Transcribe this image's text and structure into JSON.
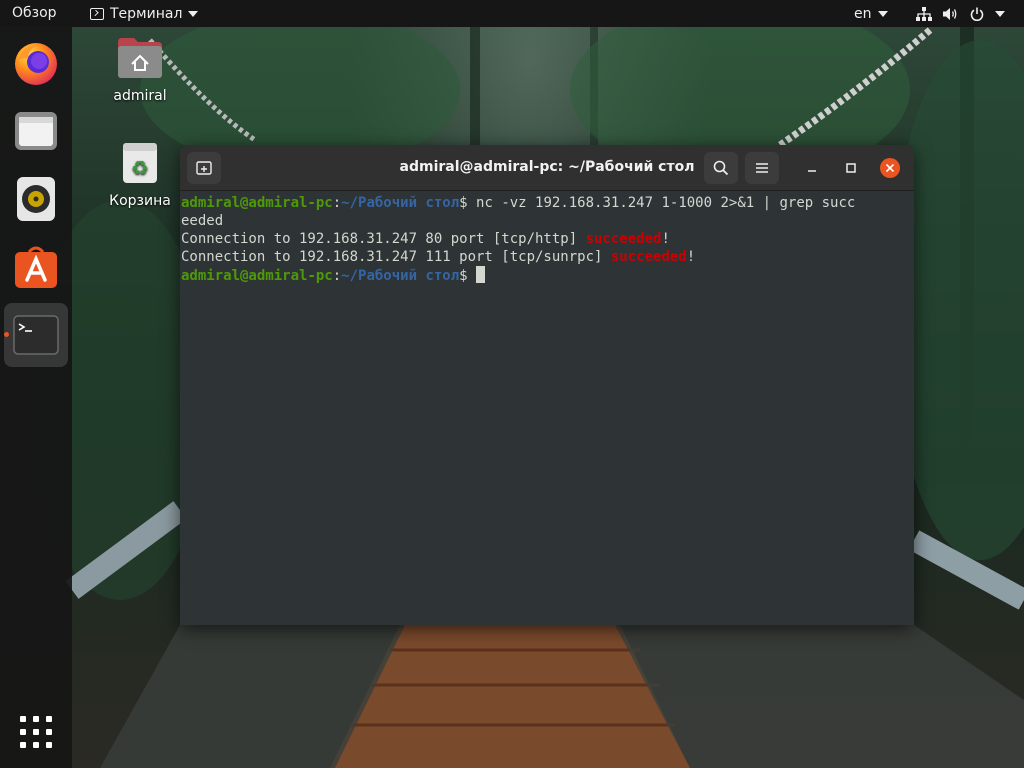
{
  "topbar": {
    "activities_label": "Обзор",
    "app_menu_label": "Терминал",
    "keyboard_layout": "en"
  },
  "dock": {
    "items": [
      "firefox-icon",
      "files-icon",
      "rhythmbox-icon",
      "software-icon",
      "terminal-icon"
    ],
    "apps_grid_icon": "show-applications-icon"
  },
  "desktop": {
    "home_label": "admiral",
    "trash_label": "Корзина"
  },
  "terminal": {
    "window_title": "admiral@admiral-pc: ~/Рабочий стол",
    "lines": [
      {
        "user_host": "admiral@admiral-pc",
        "colon": ":",
        "path": "~/Рабочий стол",
        "dollar": "$",
        "command": " nc -vz 192.168.31.247 1-1000 2>&1 | grep succ"
      },
      {
        "text": "eeded"
      },
      {
        "prefix": "Connection to 192.168.31.247 80 port [tcp/http] ",
        "highlight": "succeeded",
        "suffix": "!"
      },
      {
        "prefix": "Connection to 192.168.31.247 111 port [tcp/sunrpc] ",
        "highlight": "succeeded",
        "suffix": "!"
      },
      {
        "user_host": "admiral@admiral-pc",
        "colon": ":",
        "path": "~/Рабочий стол",
        "dollar": "$",
        "command": " "
      }
    ],
    "colors": {
      "background": "#2e3436",
      "user_host": "#4e9a06",
      "path": "#3465a4",
      "highlight": "#cc0000",
      "close_button": "#e95420"
    }
  }
}
